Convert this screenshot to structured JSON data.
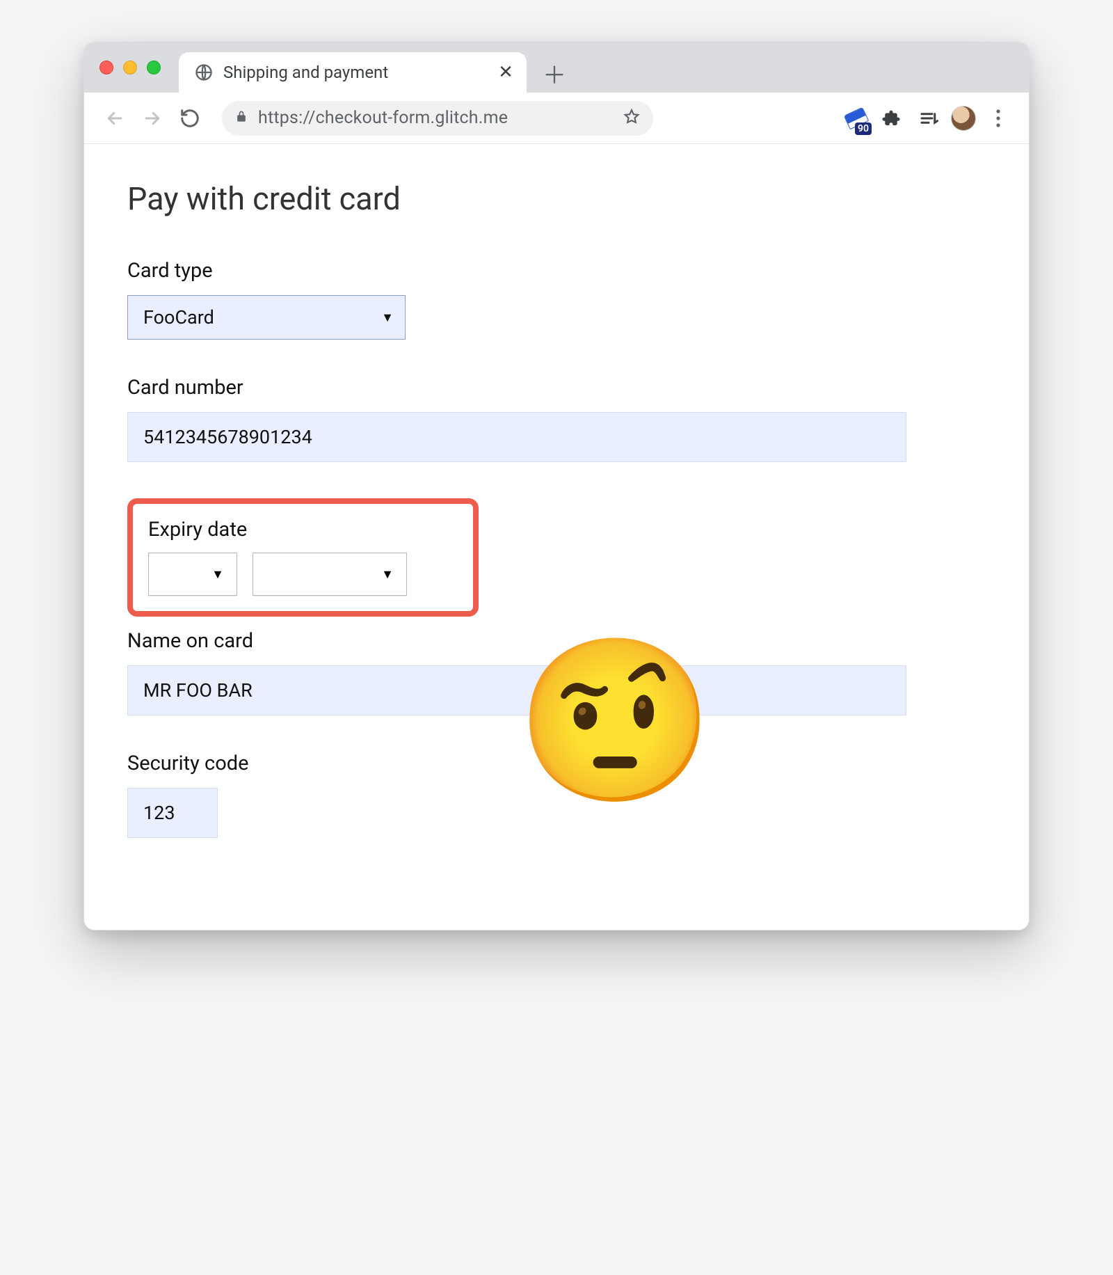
{
  "browser": {
    "tab_title": "Shipping and payment",
    "url": "https://checkout-form.glitch.me",
    "extension_badge": "90"
  },
  "page": {
    "heading": "Pay with credit card",
    "card_type": {
      "label": "Card type",
      "value": "FooCard"
    },
    "card_number": {
      "label": "Card number",
      "value": "5412345678901234"
    },
    "expiry": {
      "label": "Expiry date",
      "month": "",
      "year": ""
    },
    "name_on_card": {
      "label": "Name on card",
      "value": "MR FOO BAR"
    },
    "security_code": {
      "label": "Security code",
      "value": "123"
    },
    "emoji": "🤨"
  }
}
